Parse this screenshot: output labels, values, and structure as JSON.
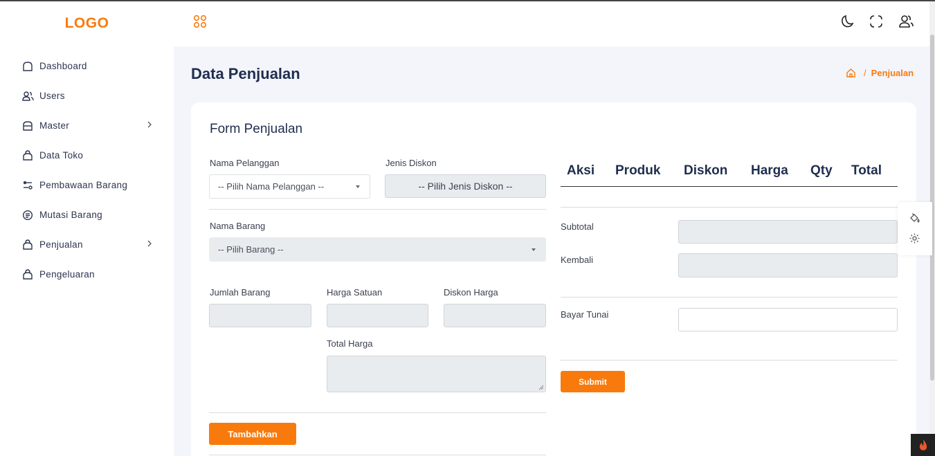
{
  "logo": "LOGO",
  "sidebar": {
    "items": [
      {
        "label": "Dashboard",
        "icon": "home-icon"
      },
      {
        "label": "Users",
        "icon": "users-icon"
      },
      {
        "label": "Master",
        "icon": "folder-icon",
        "has_submenu": true
      },
      {
        "label": "Data Toko",
        "icon": "bag-icon"
      },
      {
        "label": "Pembawaan Barang",
        "icon": "filter-icon"
      },
      {
        "label": "Mutasi Barang",
        "icon": "list-icon"
      },
      {
        "label": "Penjualan",
        "icon": "bag-icon",
        "has_submenu": true
      },
      {
        "label": "Pengeluaran",
        "icon": "bag-icon"
      }
    ]
  },
  "header": {
    "icons": [
      "apps-icon",
      "moon-icon",
      "fullscreen-icon",
      "user-icon"
    ]
  },
  "page": {
    "title": "Data Penjualan",
    "breadcrumb": {
      "home_icon": "home-icon",
      "separator": "/",
      "current": "Penjualan"
    }
  },
  "form": {
    "title": "Form Penjualan",
    "nama_pelanggan_label": "Nama Pelanggan",
    "nama_pelanggan_placeholder": "-- Pilih Nama Pelanggan --",
    "jenis_diskon_label": "Jenis Diskon",
    "jenis_diskon_placeholder": "-- Pilih Jenis Diskon --",
    "nama_barang_label": "Nama Barang",
    "nama_barang_placeholder": "-- Pilih Barang --",
    "jumlah_barang_label": "Jumlah Barang",
    "harga_satuan_label": "Harga Satuan",
    "diskon_harga_label": "Diskon Harga",
    "total_harga_label": "Total Harga",
    "tambahkan_button": "Tambahkan"
  },
  "table": {
    "columns": [
      "Aksi",
      "Produk",
      "Diskon",
      "Harga",
      "Qty",
      "Total"
    ],
    "rows": []
  },
  "summary": {
    "subtotal_label": "Subtotal",
    "kembali_label": "Kembali",
    "bayar_tunai_label": "Bayar Tunai",
    "submit_button": "Submit"
  },
  "side_widget": {
    "icons": [
      "paint-bucket-icon",
      "gear-icon"
    ]
  },
  "colors": {
    "accent": "#f97a0c",
    "title": "#1f2d4e",
    "background": "#f3f5fb"
  }
}
